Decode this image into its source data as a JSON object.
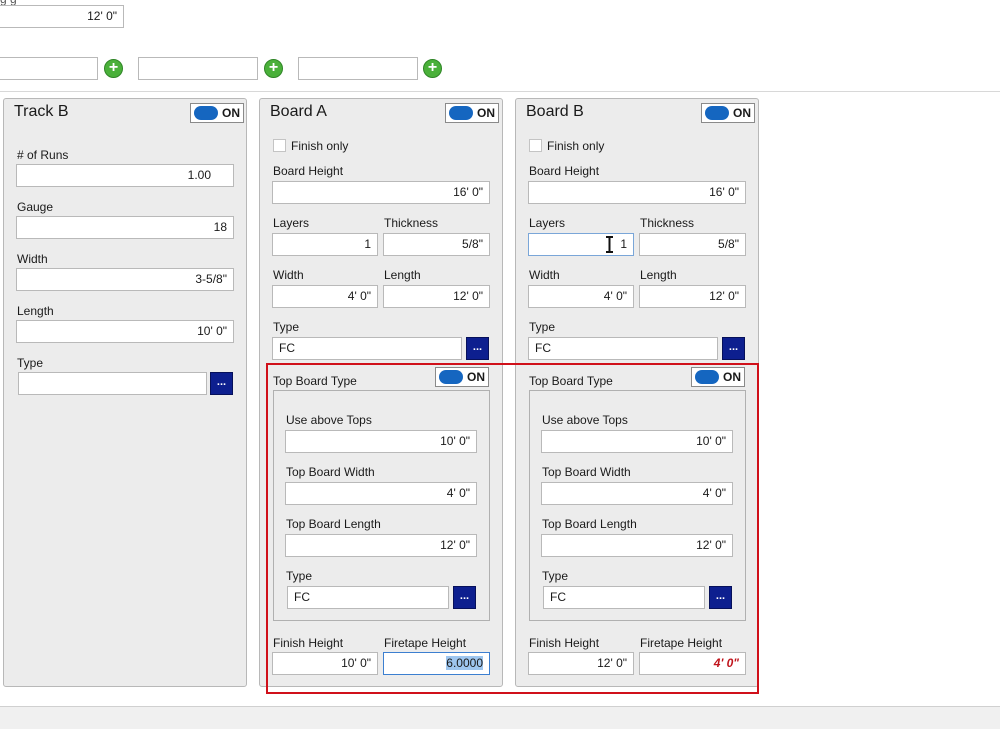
{
  "top": {
    "partial_label": "g  g",
    "height_value": "12' 0\"",
    "add_fields": [
      "",
      "",
      ""
    ]
  },
  "track_b": {
    "title": "Track B",
    "toggle": "ON",
    "runs_label": "# of Runs",
    "runs_value": "1.00",
    "gauge_label": "Gauge",
    "gauge_value": "18",
    "width_label": "Width",
    "width_value": "3-5/8\"",
    "length_label": "Length",
    "length_value": "10' 0\"",
    "type_label": "Type",
    "type_value": "",
    "browse": "..."
  },
  "board_a": {
    "title": "Board A",
    "toggle": "ON",
    "finish_only": "Finish only",
    "board_height_label": "Board Height",
    "board_height_value": "16' 0\"",
    "layers_label": "Layers",
    "layers_value": "1",
    "thickness_label": "Thickness",
    "thickness_value": "5/8\"",
    "width_label": "Width",
    "width_value": "4' 0\"",
    "length_label": "Length",
    "length_value": "12' 0\"",
    "type_label": "Type",
    "type_value": "FC",
    "browse": "...",
    "top_board": {
      "title": "Top Board Type",
      "toggle": "ON",
      "use_above_label": "Use above Tops",
      "use_above_value": "10' 0\"",
      "width_label": "Top Board Width",
      "width_value": "4' 0\"",
      "length_label": "Top Board Length",
      "length_value": "12' 0\"",
      "type_label": "Type",
      "type_value": "FC",
      "browse": "..."
    },
    "finish_height_label": "Finish Height",
    "finish_height_value": "10' 0\"",
    "firetape_label": "Firetape Height",
    "firetape_value": "6.0000"
  },
  "board_b": {
    "title": "Board B",
    "toggle": "ON",
    "finish_only": "Finish only",
    "board_height_label": "Board Height",
    "board_height_value": "16' 0\"",
    "layers_label": "Layers",
    "layers_value": "1",
    "thickness_label": "Thickness",
    "thickness_value": "5/8\"",
    "width_label": "Width",
    "width_value": "4' 0\"",
    "length_label": "Length",
    "length_value": "12' 0\"",
    "type_label": "Type",
    "type_value": "FC",
    "browse": "...",
    "top_board": {
      "title": "Top Board Type",
      "toggle": "ON",
      "use_above_label": "Use above Tops",
      "use_above_value": "10' 0\"",
      "width_label": "Top Board Width",
      "width_value": "4' 0\"",
      "length_label": "Top Board Length",
      "length_value": "12' 0\"",
      "type_label": "Type",
      "type_value": "FC",
      "browse": "..."
    },
    "finish_height_label": "Finish Height",
    "finish_height_value": "12' 0\"",
    "firetape_label": "Firetape Height",
    "firetape_value": "4' 0\""
  },
  "colors": {
    "toggle_on": "#1566c0",
    "browse_button": "#0d1f8f",
    "add_button": "#4ab03a",
    "highlight_border": "#d0101a",
    "error_text": "#c0141c",
    "selection": "#9ec6ef"
  },
  "icons": [
    "plus-circle-icon",
    "toggle-switch-icon",
    "ellipsis-icon",
    "text-cursor-icon"
  ]
}
